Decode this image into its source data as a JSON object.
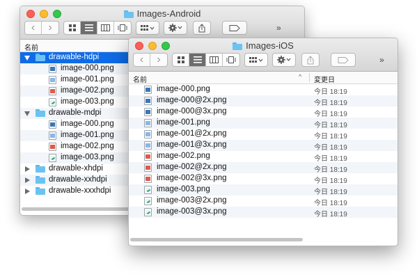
{
  "android_window": {
    "title": "Images-Android",
    "column_name": "名前",
    "rows": [
      {
        "kind": "folder",
        "expanded": true,
        "selected": true,
        "label": "drawable-hdpi"
      },
      {
        "kind": "file",
        "icon": "monitor",
        "label": "image-000.png"
      },
      {
        "kind": "file",
        "icon": "blue",
        "label": "image-001.png"
      },
      {
        "kind": "file",
        "icon": "red",
        "label": "image-002.png"
      },
      {
        "kind": "file",
        "icon": "green",
        "label": "image-003.png"
      },
      {
        "kind": "folder",
        "expanded": true,
        "selected": false,
        "label": "drawable-mdpi"
      },
      {
        "kind": "file",
        "icon": "monitor",
        "label": "image-000.png"
      },
      {
        "kind": "file",
        "icon": "blue",
        "label": "image-001.png"
      },
      {
        "kind": "file",
        "icon": "red",
        "label": "image-002.png"
      },
      {
        "kind": "file",
        "icon": "green",
        "label": "image-003.png"
      },
      {
        "kind": "folder",
        "expanded": false,
        "selected": false,
        "label": "drawable-xhdpi"
      },
      {
        "kind": "folder",
        "expanded": false,
        "selected": false,
        "label": "drawable-xxhdpi"
      },
      {
        "kind": "folder",
        "expanded": false,
        "selected": false,
        "label": "drawable-xxxhdpi"
      }
    ]
  },
  "ios_window": {
    "title": "Images-iOS",
    "column_name": "名前",
    "column_date": "変更日",
    "sort_indicator": "^",
    "rows": [
      {
        "icon": "monitor",
        "label": "image-000.png",
        "date": "今日 18:19"
      },
      {
        "icon": "monitor",
        "label": "image-000@2x.png",
        "date": "今日 18:19"
      },
      {
        "icon": "monitor",
        "label": "image-000@3x.png",
        "date": "今日 18:19"
      },
      {
        "icon": "blue",
        "label": "image-001.png",
        "date": "今日 18:19"
      },
      {
        "icon": "blue",
        "label": "image-001@2x.png",
        "date": "今日 18:19"
      },
      {
        "icon": "blue",
        "label": "image-001@3x.png",
        "date": "今日 18:19"
      },
      {
        "icon": "red",
        "label": "image-002.png",
        "date": "今日 18:19"
      },
      {
        "icon": "red",
        "label": "image-002@2x.png",
        "date": "今日 18:19"
      },
      {
        "icon": "red",
        "label": "image-002@3x.png",
        "date": "今日 18:19"
      },
      {
        "icon": "green",
        "label": "image-003.png",
        "date": "今日 18:19"
      },
      {
        "icon": "green",
        "label": "image-003@2x.png",
        "date": "今日 18:19"
      },
      {
        "icon": "green",
        "label": "image-003@3x.png",
        "date": "今日 18:19"
      }
    ]
  },
  "toolbar": {
    "back_icon": "‹",
    "forward_icon": "›",
    "more_icon": "»",
    "icons": [
      "back-icon",
      "forward-icon",
      "icon-view-icon",
      "list-view-icon",
      "column-view-icon",
      "coverflow-view-icon",
      "arrange-icon",
      "gear-icon",
      "share-icon",
      "tag-icon"
    ]
  },
  "colors": {
    "selection": "#0f6ce6",
    "folder": "#6cc3f1",
    "stripe": "#f2f5f9"
  }
}
